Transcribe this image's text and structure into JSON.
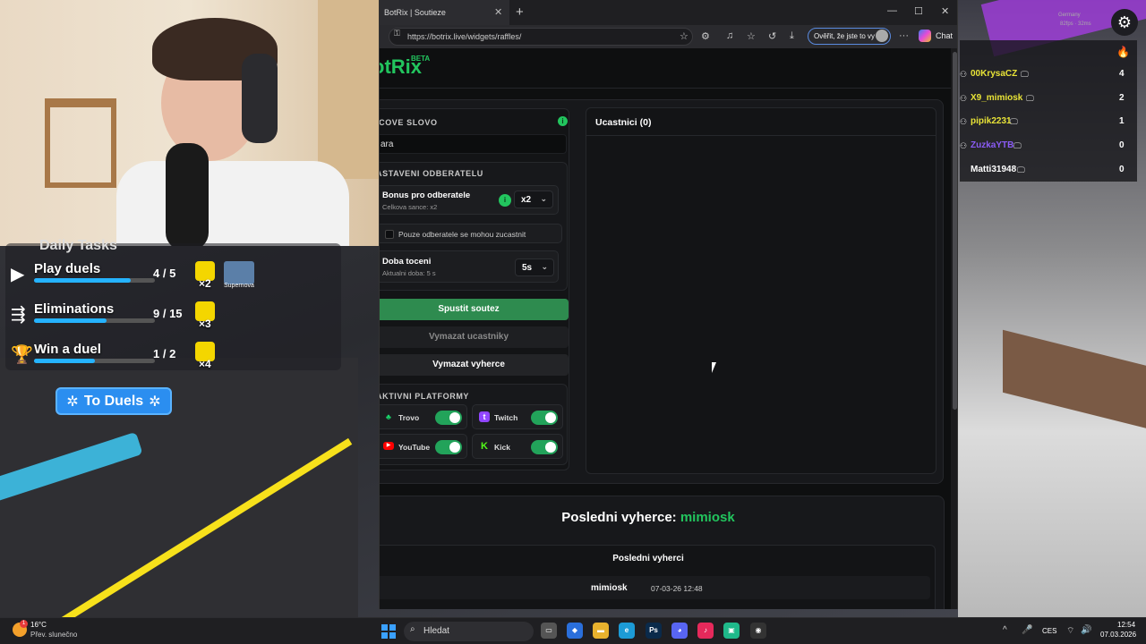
{
  "overlay": {
    "tasks_title": "Daily Tasks",
    "tasks": [
      {
        "name": "Play duels",
        "count": "4 / 5",
        "progress": 0.8,
        "multiplier": "×2",
        "badge": "Supernova"
      },
      {
        "name": "Eliminations",
        "count": "9 / 15",
        "progress": 0.6,
        "multiplier": "×3"
      },
      {
        "name": "Win a duel",
        "count": "1 / 2",
        "progress": 0.5,
        "multiplier": "×4"
      }
    ],
    "to_duels_label": "To Duels"
  },
  "browser": {
    "tab_title": "BotRix | Soutieze",
    "url": "https://botrix.live/widgets/raffles/",
    "verify_label": "Ověřit, že jste to vy",
    "chat_label": "Chat"
  },
  "page": {
    "logo": "otRix",
    "logo_badge": "BETA",
    "keyword_label": "ICOVE SLOVO",
    "keyword_value": "ara",
    "subscriber_settings_label": "ASTAVENI ODBERATELU",
    "bonus_title": "Bonus pro odberatele",
    "bonus_sub": "Celkova sance: x2",
    "bonus_value": "x2",
    "sub_only_label": "Pouze odberatele se mohou zucastnit",
    "spin_title": "Doba toceni",
    "spin_sub": "Aktualni doba: 5 s",
    "spin_value": "5s",
    "btn_start": "Spustit soutez",
    "btn_clear_participants": "Vymazat ucastniky",
    "btn_clear_winners": "Vymazat vyherce",
    "platforms_label": "AKTIVNI PLATFORMY",
    "platforms": [
      {
        "name": "Trovo",
        "color": "#19d66b",
        "enabled": true
      },
      {
        "name": "Twitch",
        "color": "#9146ff",
        "enabled": true
      },
      {
        "name": "YouTube",
        "color": "#ff0000",
        "enabled": true
      },
      {
        "name": "Kick",
        "color": "#53fc18",
        "enabled": true
      }
    ],
    "participants_title": "Ucastnici (0)",
    "last_winner_label": "Posledni vyherce:",
    "last_winner_name": "mimiosk",
    "winners_title": "Posledni vyherci",
    "winners": [
      {
        "name": "mimiosk",
        "date": "07-03-26 12:48"
      }
    ]
  },
  "leaderboard": {
    "region": "Germany",
    "fps": "82fps · 32ms",
    "rows": [
      {
        "name": "00KrysaCZ",
        "score": "4",
        "color": "#e8e337"
      },
      {
        "name": "X9_mimiosk",
        "score": "2",
        "color": "#e8e337"
      },
      {
        "name": "pipik2231",
        "score": "1",
        "color": "#e8e337"
      },
      {
        "name": "ZuzkaYTB",
        "score": "0",
        "color": "#8b5cf6"
      },
      {
        "name": "Matti31948",
        "score": "0",
        "color": "#ffffff"
      }
    ]
  },
  "taskbar": {
    "temp": "16°C",
    "weather": "Přev. slunečno",
    "search_placeholder": "Hledat",
    "language": "CES",
    "time": "12:54",
    "date": "07.03.2026",
    "apps": [
      {
        "icon": "task-view-icon",
        "color": "#555"
      },
      {
        "icon": "store-icon",
        "color": "#2a6fdb"
      },
      {
        "icon": "folder-icon",
        "color": "#e8b22e"
      },
      {
        "icon": "edge-icon",
        "color": "#1c9bd6"
      },
      {
        "icon": "photoshop-icon",
        "color": "#0a2a4a",
        "label": "Ps"
      },
      {
        "icon": "discord-icon",
        "color": "#5865f2"
      },
      {
        "icon": "tiktok-icon",
        "color": "#e6295b"
      },
      {
        "icon": "app-icon",
        "color": "#1fb98a"
      },
      {
        "icon": "obs-icon",
        "color": "#333"
      }
    ]
  }
}
